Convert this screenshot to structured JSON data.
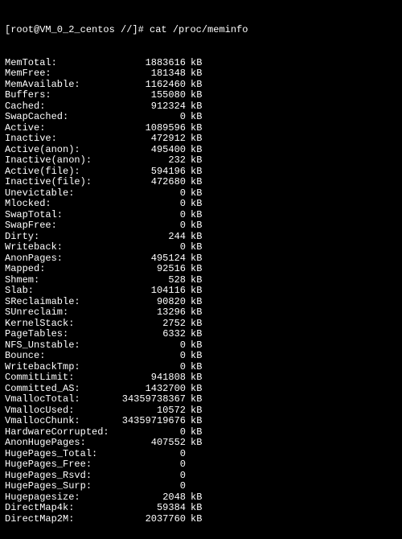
{
  "prompt": "[root@VM_0_2_centos //]# cat /proc/meminfo",
  "entries": [
    {
      "key": "MemTotal:",
      "value": "1883616",
      "unit": "kB"
    },
    {
      "key": "MemFree:",
      "value": "181348",
      "unit": "kB"
    },
    {
      "key": "MemAvailable:",
      "value": "1162460",
      "unit": "kB"
    },
    {
      "key": "Buffers:",
      "value": "155080",
      "unit": "kB"
    },
    {
      "key": "Cached:",
      "value": "912324",
      "unit": "kB"
    },
    {
      "key": "SwapCached:",
      "value": "0",
      "unit": "kB"
    },
    {
      "key": "Active:",
      "value": "1089596",
      "unit": "kB"
    },
    {
      "key": "Inactive:",
      "value": "472912",
      "unit": "kB"
    },
    {
      "key": "Active(anon):",
      "value": "495400",
      "unit": "kB"
    },
    {
      "key": "Inactive(anon):",
      "value": "232",
      "unit": "kB"
    },
    {
      "key": "Active(file):",
      "value": "594196",
      "unit": "kB"
    },
    {
      "key": "Inactive(file):",
      "value": "472680",
      "unit": "kB"
    },
    {
      "key": "Unevictable:",
      "value": "0",
      "unit": "kB"
    },
    {
      "key": "Mlocked:",
      "value": "0",
      "unit": "kB"
    },
    {
      "key": "SwapTotal:",
      "value": "0",
      "unit": "kB"
    },
    {
      "key": "SwapFree:",
      "value": "0",
      "unit": "kB"
    },
    {
      "key": "Dirty:",
      "value": "244",
      "unit": "kB"
    },
    {
      "key": "Writeback:",
      "value": "0",
      "unit": "kB"
    },
    {
      "key": "AnonPages:",
      "value": "495124",
      "unit": "kB"
    },
    {
      "key": "Mapped:",
      "value": "92516",
      "unit": "kB"
    },
    {
      "key": "Shmem:",
      "value": "528",
      "unit": "kB"
    },
    {
      "key": "Slab:",
      "value": "104116",
      "unit": "kB"
    },
    {
      "key": "SReclaimable:",
      "value": "90820",
      "unit": "kB"
    },
    {
      "key": "SUnreclaim:",
      "value": "13296",
      "unit": "kB"
    },
    {
      "key": "KernelStack:",
      "value": "2752",
      "unit": "kB"
    },
    {
      "key": "PageTables:",
      "value": "6332",
      "unit": "kB"
    },
    {
      "key": "NFS_Unstable:",
      "value": "0",
      "unit": "kB"
    },
    {
      "key": "Bounce:",
      "value": "0",
      "unit": "kB"
    },
    {
      "key": "WritebackTmp:",
      "value": "0",
      "unit": "kB"
    },
    {
      "key": "CommitLimit:",
      "value": "941808",
      "unit": "kB"
    },
    {
      "key": "Committed_AS:",
      "value": "1432700",
      "unit": "kB"
    },
    {
      "key": "VmallocTotal:",
      "value": "34359738367",
      "unit": "kB"
    },
    {
      "key": "VmallocUsed:",
      "value": "10572",
      "unit": "kB"
    },
    {
      "key": "VmallocChunk:",
      "value": "34359719676",
      "unit": "kB"
    },
    {
      "key": "HardwareCorrupted:",
      "value": "0",
      "unit": "kB"
    },
    {
      "key": "AnonHugePages:",
      "value": "407552",
      "unit": "kB"
    },
    {
      "key": "HugePages_Total:",
      "value": "0",
      "unit": ""
    },
    {
      "key": "HugePages_Free:",
      "value": "0",
      "unit": ""
    },
    {
      "key": "HugePages_Rsvd:",
      "value": "0",
      "unit": ""
    },
    {
      "key": "HugePages_Surp:",
      "value": "0",
      "unit": ""
    },
    {
      "key": "Hugepagesize:",
      "value": "2048",
      "unit": "kB"
    },
    {
      "key": "DirectMap4k:",
      "value": "59384",
      "unit": "kB"
    },
    {
      "key": "DirectMap2M:",
      "value": "2037760",
      "unit": "kB"
    }
  ]
}
